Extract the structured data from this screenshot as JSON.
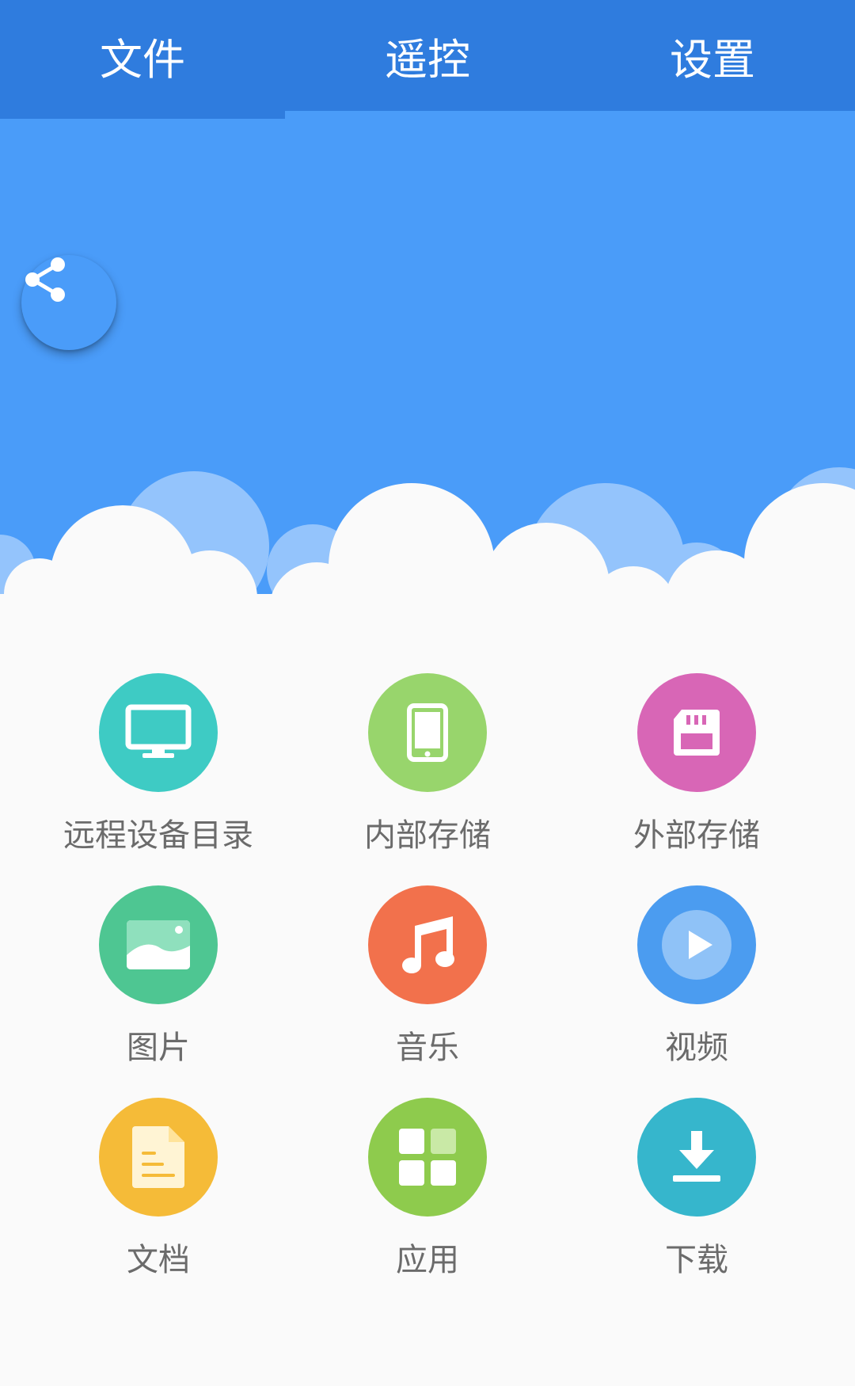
{
  "tabs": [
    {
      "label": "文件",
      "active": true
    },
    {
      "label": "遥控",
      "active": false
    },
    {
      "label": "设置",
      "active": false
    }
  ],
  "share_button": {
    "icon": "share-icon"
  },
  "grid": [
    {
      "label": "远程设备目录",
      "icon": "monitor-icon",
      "color": "#3ecbc4"
    },
    {
      "label": "内部存储",
      "icon": "phone-icon",
      "color": "#98d56c"
    },
    {
      "label": "外部存储",
      "icon": "sd-card-icon",
      "color": "#d866b6"
    },
    {
      "label": "图片",
      "icon": "image-icon",
      "color": "#4ec692"
    },
    {
      "label": "音乐",
      "icon": "music-icon",
      "color": "#f2714c"
    },
    {
      "label": "视频",
      "icon": "video-icon",
      "color": "#4b9cf0"
    },
    {
      "label": "文档",
      "icon": "document-icon",
      "color": "#f5bb38"
    },
    {
      "label": "应用",
      "icon": "apps-icon",
      "color": "#8ecb4d"
    },
    {
      "label": "下载",
      "icon": "download-icon",
      "color": "#36b6cc"
    }
  ],
  "colors": {
    "tabbar": "#2f7cde",
    "hero": "#4a9cf9",
    "background": "#fafafa"
  }
}
